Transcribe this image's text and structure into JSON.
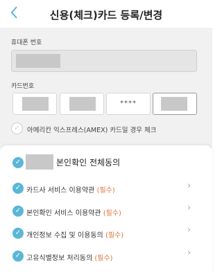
{
  "header": {
    "back_icon": "chevron-left-icon",
    "title": "신용(체크)카드 등록/변경"
  },
  "form": {
    "phone_label": "휴대폰 번호",
    "card_label": "카드번호",
    "card_third_segment": "****",
    "amex_label": "아메리칸 익스프레스(AMEX) 카드일 경우 체크"
  },
  "agreement": {
    "all_label": "본인확인 전체동의",
    "items": [
      {
        "label": "카드사 서비스 이용약관",
        "required": "(필수)"
      },
      {
        "label": "본인확인 서비스 이용약관",
        "required": "(필수)"
      },
      {
        "label": "개인정보 수집 및 이용동의",
        "required": "(필수)"
      },
      {
        "label": "고유식별정보 처리동의",
        "required": "(필수)"
      }
    ]
  },
  "colors": {
    "accent": "#5ab7d6",
    "required": "#e0753a"
  }
}
